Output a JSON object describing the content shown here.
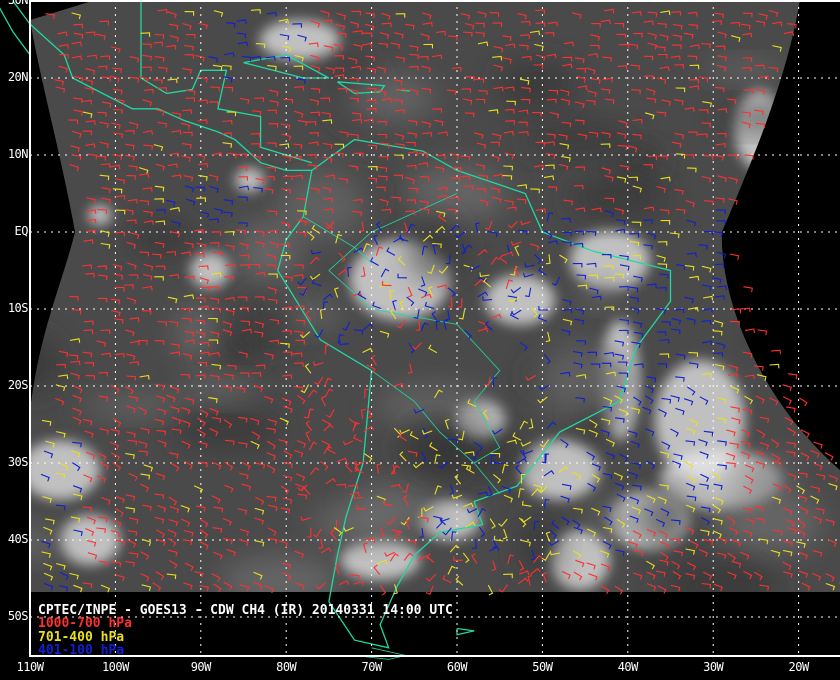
{
  "title": "CPTEC/INPE - GOES13 - CDW CH4 (IR) 20140331 14:00 UTC",
  "legend": [
    {
      "label": "1000-700 hPa",
      "color": "#ff3030"
    },
    {
      "label": "701-400 hPa",
      "color": "#e8e020"
    },
    {
      "label": "401-100 hPa",
      "color": "#1020d0"
    }
  ],
  "lat_labels": [
    "30N",
    "20N",
    "10N",
    "EQ",
    "10S",
    "20S",
    "30S",
    "40S",
    "50S"
  ],
  "lon_labels": [
    "110W",
    "100W",
    "90W",
    "80W",
    "70W",
    "60W",
    "50W",
    "40W",
    "30W",
    "20W"
  ],
  "colors": {
    "coastline": "#20d8a0",
    "grid": "#ffffff",
    "background": "#000000"
  }
}
